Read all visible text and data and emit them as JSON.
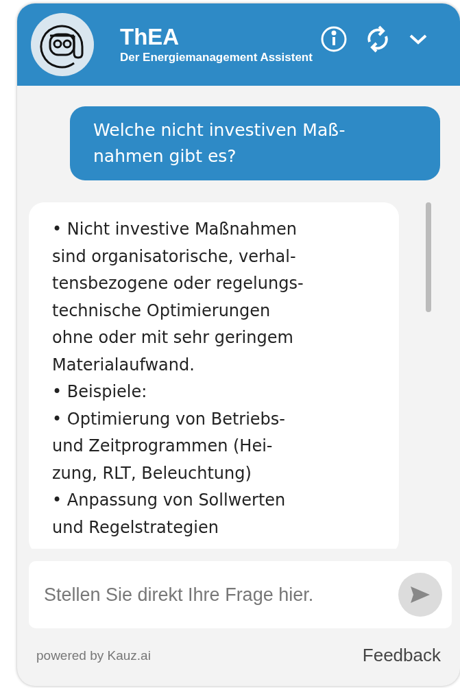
{
  "header": {
    "title": "ThEA",
    "subtitle": "Der Energiemanagement Assistent"
  },
  "messages": [
    {
      "kind": "user",
      "lines": [
        "Welche nicht investiven Maß-",
        "nahmen gibt es?"
      ]
    },
    {
      "kind": "bot",
      "lines": [
        "• Nicht investive Maßnahmen",
        "sind organisatorische, verhal-",
        "tensbezogene oder regelungs-",
        "technische Optimierungen",
        "ohne oder mit sehr geringem",
        "Materialaufwand.",
        "• Beispiele:",
        "• Optimierung von Betriebs-",
        "und Zeitprogrammen (Hei-",
        "zung, RLT, Beleuchtung)",
        "• Anpassung von Sollwerten",
        "und Regelstrategien"
      ]
    }
  ],
  "input": {
    "placeholder": "Stellen Sie direkt Ihre Frage hier."
  },
  "footer": {
    "powered_by": "powered by Kauz.ai",
    "feedback": "Feedback"
  }
}
